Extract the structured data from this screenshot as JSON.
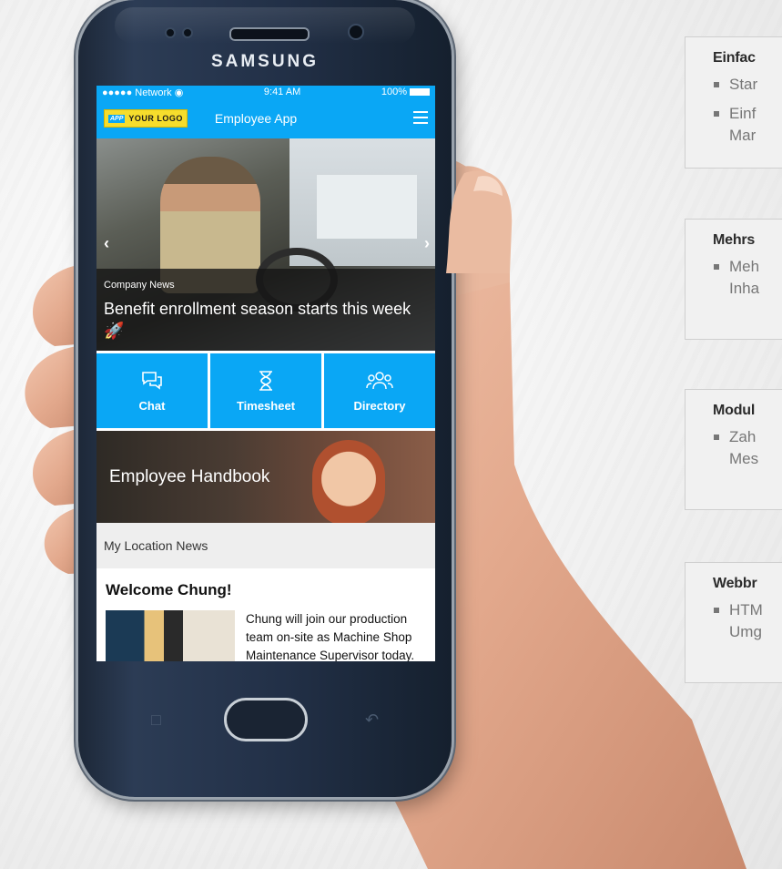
{
  "phone": {
    "brand": "SAMSUNG"
  },
  "status": {
    "network": "●●●●● Network",
    "wifi": "◉",
    "time": "9:41 AM",
    "battery": "100%"
  },
  "appbar": {
    "logo_tag": "APP",
    "logo_text": "YOUR LOGO",
    "title": "Employee App"
  },
  "hero": {
    "category": "Company News",
    "headline": "Benefit enrollment season starts this week 🚀",
    "prev": "‹",
    "next": "›"
  },
  "tiles": [
    {
      "label": "Chat",
      "icon": "chat-icon"
    },
    {
      "label": "Timesheet",
      "icon": "hourglass-icon"
    },
    {
      "label": "Directory",
      "icon": "people-icon"
    }
  ],
  "banner": {
    "title": "Employee Handbook"
  },
  "section": {
    "title": "My Location News"
  },
  "news": {
    "title": "Welcome Chung!",
    "body": "Chung will join our production team on-site as Machine Shop Maintenance Supervisor today. Please"
  },
  "cards": [
    {
      "title": "Einfac",
      "items": [
        "Star",
        "Einf…Mar"
      ]
    },
    {
      "title": "Mehrs",
      "items": [
        "Meh…Inha"
      ]
    },
    {
      "title": "Modul",
      "items": [
        "Zah…Mes"
      ]
    },
    {
      "title": "Webbr",
      "items": [
        "HTM…Umg"
      ]
    }
  ],
  "cards_text": {
    "c1_title": "Einfac",
    "c1_i1": "Star",
    "c1_i2a": "Einf",
    "c1_i2b": "Mar",
    "c2_title": "Mehrs",
    "c2_i1a": "Meh",
    "c2_i1b": "Inha",
    "c3_title": "Modul",
    "c3_i1a": "Zah",
    "c3_i1b": "Mes",
    "c4_title": "Webbr",
    "c4_i1a": "HTM",
    "c4_i1b": "Umg"
  },
  "colors": {
    "accent": "#0aa7f5",
    "logo_yellow": "#f6dd2c",
    "phone_body": "#223047"
  }
}
